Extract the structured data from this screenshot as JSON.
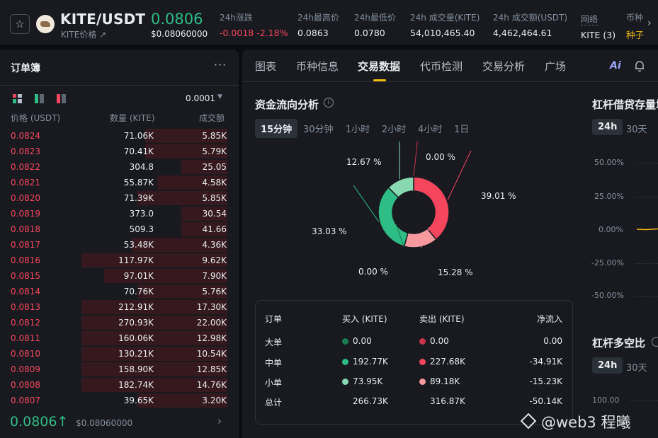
{
  "header": {
    "favorite_icon": "star-outline-icon",
    "coin_logo": "kite-logo",
    "pair": "KITE/USDT",
    "sub_label": "KITE价格 ↗",
    "last_price": "0.0806",
    "last_price_usd": "$0.08060000",
    "stats": [
      {
        "label": "24h涨跌",
        "value": "-0.0018 -2.18%",
        "tone": "red"
      },
      {
        "label": "24h最高价",
        "value": "0.0863",
        "tone": "normal"
      },
      {
        "label": "24h最低价",
        "value": "0.0780",
        "tone": "normal"
      },
      {
        "label": "24h 成交量(KITE)",
        "value": "54,010,465.40",
        "tone": "normal"
      },
      {
        "label": "24h 成交额(USDT)",
        "value": "4,462,464.61",
        "tone": "normal"
      },
      {
        "label": "网络",
        "value": "KITE (3)",
        "tone": "normal"
      },
      {
        "label": "币种",
        "value": "种子",
        "tone": "gold"
      }
    ],
    "scroll_icon": "chevron-right-icon"
  },
  "orderbook": {
    "title": "订单簿",
    "more_icon": "more-dots-icon",
    "tick_size": "0.0001",
    "columns": [
      "价格 (USDT)",
      "数量 (KITE)",
      "成交额"
    ],
    "asks": [
      {
        "price": "0.0824",
        "qty": "71.06K",
        "total": "5.85K",
        "depth": 0.54
      },
      {
        "price": "0.0823",
        "qty": "70.41K",
        "total": "5.79K",
        "depth": 0.54
      },
      {
        "price": "0.0822",
        "qty": "304.8",
        "total": "25.05",
        "depth": 0.3
      },
      {
        "price": "0.0821",
        "qty": "55.87K",
        "total": "4.58K",
        "depth": 0.46
      },
      {
        "price": "0.0820",
        "qty": "71.39K",
        "total": "5.85K",
        "depth": 0.59
      },
      {
        "price": "0.0819",
        "qty": "373.0",
        "total": "30.54",
        "depth": 0.3
      },
      {
        "price": "0.0818",
        "qty": "509.3",
        "total": "41.66",
        "depth": 0.3
      },
      {
        "price": "0.0817",
        "qty": "53.48K",
        "total": "4.36K",
        "depth": 0.63
      },
      {
        "price": "0.0816",
        "qty": "117.97K",
        "total": "9.62K",
        "depth": 0.96
      },
      {
        "price": "0.0815",
        "qty": "97.01K",
        "total": "7.90K",
        "depth": 0.81
      },
      {
        "price": "0.0814",
        "qty": "70.76K",
        "total": "5.76K",
        "depth": 0.59
      },
      {
        "price": "0.0813",
        "qty": "212.91K",
        "total": "17.30K",
        "depth": 0.96
      },
      {
        "price": "0.0812",
        "qty": "270.93K",
        "total": "22.00K",
        "depth": 0.96
      },
      {
        "price": "0.0811",
        "qty": "160.06K",
        "total": "12.98K",
        "depth": 0.96
      },
      {
        "price": "0.0810",
        "qty": "130.21K",
        "total": "10.54K",
        "depth": 0.96
      },
      {
        "price": "0.0809",
        "qty": "158.90K",
        "total": "12.85K",
        "depth": 0.96
      },
      {
        "price": "0.0808",
        "qty": "182.74K",
        "total": "14.76K",
        "depth": 0.96
      },
      {
        "price": "0.0807",
        "qty": "39.65K",
        "total": "3.20K",
        "depth": 0.59
      }
    ],
    "last_price": "0.0806↑",
    "last_price_usd": "$0.08060000",
    "chevron_icon": "chevron-right-icon"
  },
  "tabs": [
    "图表",
    "币种信息",
    "交易数据",
    "代币检测",
    "交易分析",
    "广场"
  ],
  "active_tab": "交易数据",
  "ai_label": "Ai",
  "bell_icon": "bell-icon",
  "fund_flow": {
    "title": "资金流向分析",
    "info_icon": "info-circle-icon",
    "periods": [
      "15分钟",
      "30分钟",
      "1小时",
      "2小时",
      "4小时",
      "1日"
    ],
    "active_period": "15分钟",
    "table": {
      "headers": [
        "订单",
        "买入 (KITE)",
        "卖出 (KITE)",
        "净流入"
      ],
      "rows": [
        {
          "label": "大单",
          "buy": "0.00",
          "sell": "0.00",
          "net": "0.00",
          "buy_color": "#1a7a52",
          "sell_color": "#c7344a"
        },
        {
          "label": "中单",
          "buy": "192.77K",
          "sell": "227.68K",
          "net": "-34.91K",
          "buy_color": "#2ebd85",
          "sell_color": "#f6465d"
        },
        {
          "label": "小单",
          "buy": "73.95K",
          "sell": "89.18K",
          "net": "-15.23K",
          "buy_color": "#88d8b2",
          "sell_color": "#f7999f"
        }
      ],
      "total": {
        "label": "总计",
        "buy": "266.73K",
        "sell": "316.87K",
        "net": "-50.14K"
      }
    }
  },
  "chart_data": {
    "type": "pie",
    "slices": [
      {
        "label": "0.00 %",
        "value": 0.0,
        "color": "#c7344a"
      },
      {
        "label": "39.01 %",
        "value": 39.01,
        "color": "#f6465d"
      },
      {
        "label": "15.28 %",
        "value": 15.28,
        "color": "#f7999f"
      },
      {
        "label": "0.00 %",
        "value": 0.0,
        "color": "#1a7a52"
      },
      {
        "label": "33.03 %",
        "value": 33.03,
        "color": "#2ebd85"
      },
      {
        "label": "12.67 %",
        "value": 12.67,
        "color": "#88d8b2"
      }
    ]
  },
  "margin_loan": {
    "title": "杠杆借贷存量增",
    "periods": [
      "24h",
      "30天"
    ],
    "active_period": "24h",
    "y_ticks": [
      "50.00%",
      "25.00%",
      "0.00%",
      "-25.00%",
      "-50.00%"
    ]
  },
  "long_short": {
    "title": "杠杆多空比",
    "info_icon": "info-circle-icon",
    "periods": [
      "24h",
      "30天"
    ],
    "active_period": "24h",
    "y_tick": "100.00"
  },
  "watermark": "@web3  程曦"
}
